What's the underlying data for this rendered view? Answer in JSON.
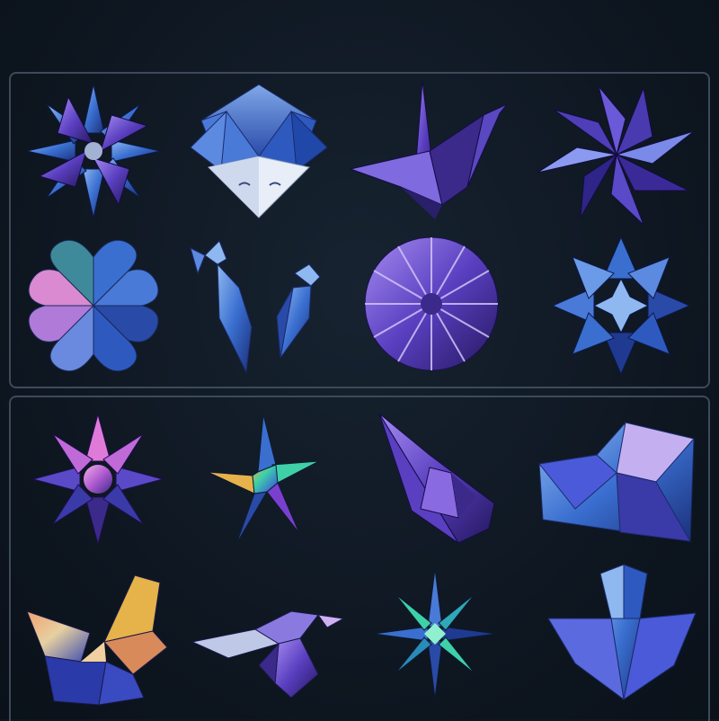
{
  "colors": {
    "background": "#0e1722",
    "panel_border": "#3d4a5a",
    "galaxy_blue": "#3a6fd0",
    "deep_purple": "#3b2a8a",
    "violet": "#7b5cd6",
    "pink": "#d98ad0",
    "iridescent_green": "#3fd0a8",
    "gold": "#e6b24a"
  },
  "panels": [
    {
      "name": "top-panel",
      "items": [
        {
          "name": "lotus-flower-origami"
        },
        {
          "name": "fox-face-origami"
        },
        {
          "name": "paper-crane-origami"
        },
        {
          "name": "eight-point-star-flower-origami"
        },
        {
          "name": "four-heart-clover-origami"
        },
        {
          "name": "bird-pair-origami"
        },
        {
          "name": "fan-medallion-origami"
        },
        {
          "name": "star-rosette-origami"
        }
      ]
    },
    {
      "name": "bottom-panel",
      "items": [
        {
          "name": "pink-lotus-origami"
        },
        {
          "name": "iridescent-star-origami"
        },
        {
          "name": "paper-boat-origami"
        },
        {
          "name": "envelope-origami"
        },
        {
          "name": "butterfly-origami"
        },
        {
          "name": "hummingbird-origami"
        },
        {
          "name": "teal-eight-point-star-origami"
        },
        {
          "name": "tulip-origami"
        }
      ]
    }
  ]
}
